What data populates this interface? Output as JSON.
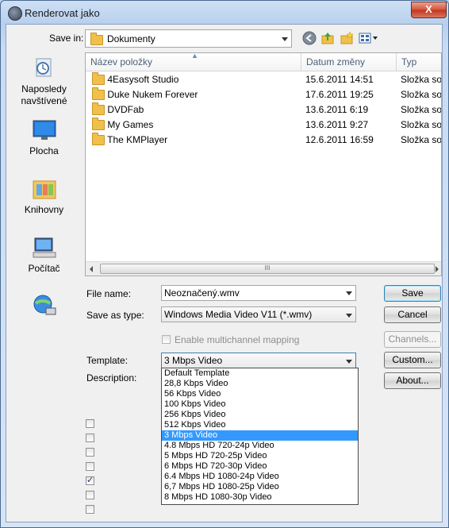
{
  "window": {
    "title": "Renderovat jako",
    "close_glyph": "X"
  },
  "toolbar": {
    "save_in_label": "Save in:",
    "location": "Dokumenty"
  },
  "places": [
    {
      "label": "Naposledy\nnavštívené",
      "icon": "recent-places-icon"
    },
    {
      "label": "Plocha",
      "icon": "desktop-icon"
    },
    {
      "label": "Knihovny",
      "icon": "libraries-icon"
    },
    {
      "label": "Počítač",
      "icon": "computer-icon"
    },
    {
      "label": "",
      "icon": "network-icon"
    }
  ],
  "file_list": {
    "columns": [
      "Název položky",
      "Datum změny",
      "Typ"
    ],
    "rows": [
      {
        "name": "4Easysoft Studio",
        "date": "15.6.2011 14:51",
        "type": "Složka souborů"
      },
      {
        "name": "Duke Nukem Forever",
        "date": "17.6.2011 19:25",
        "type": "Složka souborů"
      },
      {
        "name": "DVDFab",
        "date": "13.6.2011 6:19",
        "type": "Složka souborů"
      },
      {
        "name": "My Games",
        "date": "13.6.2011 9:27",
        "type": "Složka souborů"
      },
      {
        "name": "The KMPlayer",
        "date": "12.6.2011 16:59",
        "type": "Složka souborů"
      }
    ],
    "scroll_grip": "III"
  },
  "form": {
    "file_name_label": "File name:",
    "file_name_value": "Neoznačený.wmv",
    "save_as_type_label": "Save as type:",
    "save_as_type_value": "Windows Media Video V11 (*.wmv)",
    "multichannel_label": "Enable multichannel mapping",
    "template_label": "Template:",
    "template_value": "3 Mbps Video",
    "description_label": "Description:"
  },
  "buttons": {
    "save": "Save",
    "cancel": "Cancel",
    "channels": "Channels...",
    "custom": "Custom...",
    "about": "About..."
  },
  "template_options": [
    "Default Template",
    "28,8 Kbps Video",
    "56 Kbps Video",
    "100 Kbps Video",
    "256 Kbps Video",
    "512 Kbps Video",
    "3 Mbps Video",
    "4.8 Mbps HD 720-24p Video",
    "5 Mbps HD 720-25p Video",
    "6 Mbps HD 720-30p Video",
    "6.4 Mbps HD 1080-24p Video",
    "6,7 Mbps HD 1080-25p Video",
    "8 Mbps HD 1080-30p Video"
  ],
  "template_selected_index": 6,
  "left_checkboxes": [
    false,
    false,
    false,
    false,
    true,
    false,
    false
  ]
}
